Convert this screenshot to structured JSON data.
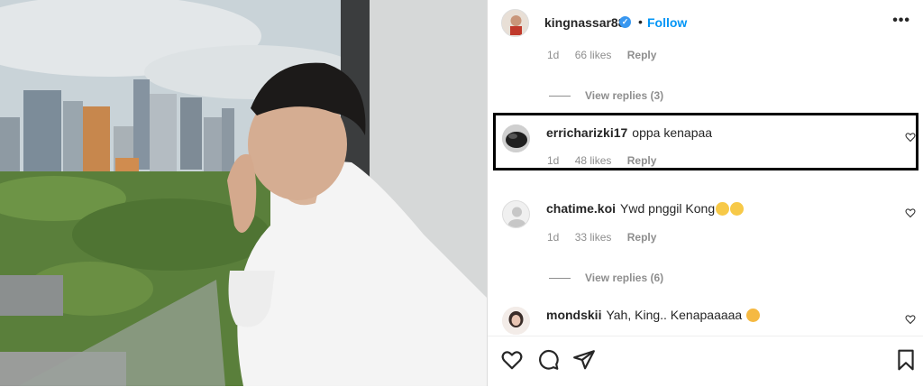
{
  "post": {
    "username": "kingnassar88",
    "verified_mark": "✓",
    "separator": "•",
    "follow_label": "Follow",
    "more_label": "•••"
  },
  "comments": {
    "top_meta": {
      "time": "1d",
      "likes": "66 likes",
      "reply": "Reply"
    },
    "view_replies_1": "View replies (3)",
    "c1": {
      "user": "erricharizki17",
      "text": "oppa kenapaa",
      "time": "1d",
      "likes": "48 likes",
      "reply": "Reply"
    },
    "c2": {
      "user": "chatime.koi",
      "text": "Ywd pnggil Kong",
      "time": "1d",
      "likes": "33 likes",
      "reply": "Reply"
    },
    "view_replies_2": "View replies (6)",
    "c3": {
      "user": "mondskii",
      "text": "Yah, King.. Kenapaaaaa"
    }
  },
  "icons": {
    "heart": "heart-icon",
    "comment": "comment-icon",
    "share": "share-icon",
    "save": "bookmark-icon",
    "verified": "verified-badge-icon"
  },
  "colors": {
    "accent": "#0095f6",
    "muted": "#8e8e8e",
    "text": "#262626"
  }
}
